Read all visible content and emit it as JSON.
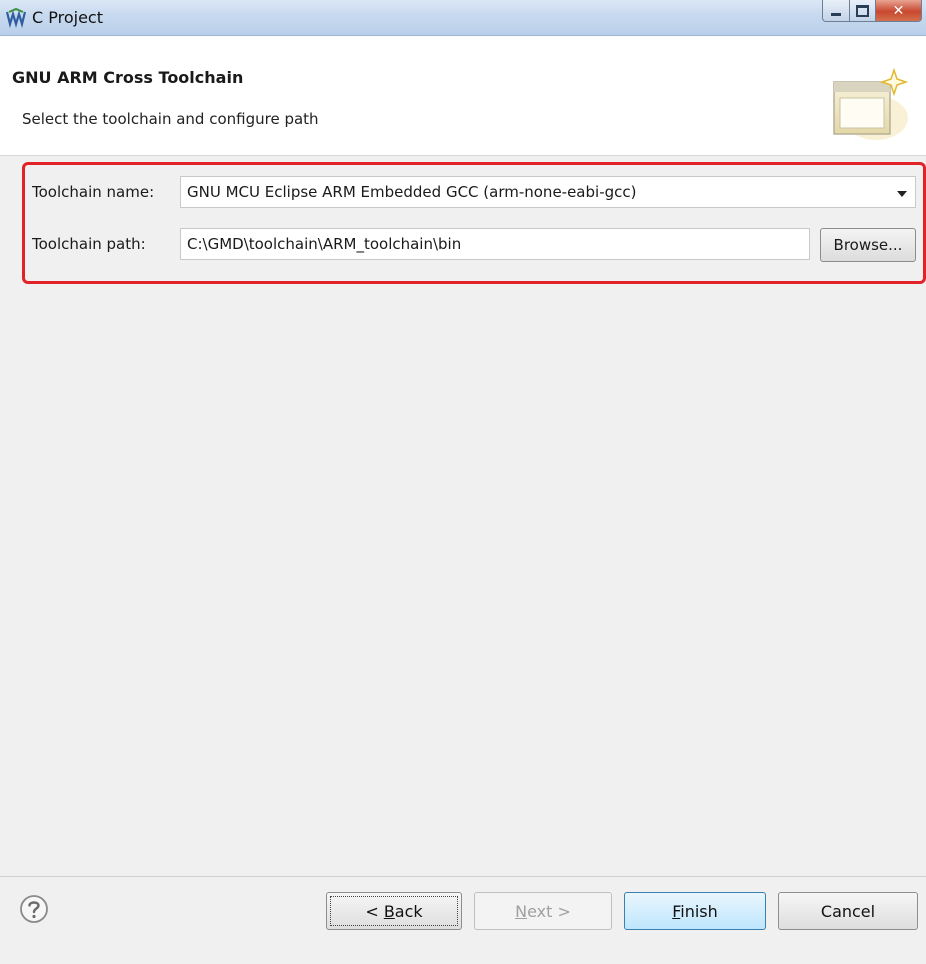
{
  "window": {
    "title": "C Project"
  },
  "header": {
    "title": "GNU ARM Cross Toolchain",
    "description": "Select the toolchain and configure path"
  },
  "form": {
    "toolchain_name_label": "Toolchain name:",
    "toolchain_name_value": "GNU MCU Eclipse ARM Embedded GCC (arm-none-eabi-gcc)",
    "toolchain_path_label": "Toolchain path:",
    "toolchain_path_value": "C:\\GMD\\toolchain\\ARM_toolchain\\bin",
    "browse_label": "Browse..."
  },
  "footer": {
    "back_prefix": "< ",
    "back_mnemonic": "B",
    "back_rest": "ack",
    "next_mnemonic": "N",
    "next_rest": "ext >",
    "finish_mnemonic": "F",
    "finish_rest": "inish",
    "cancel_label": "Cancel"
  },
  "colors": {
    "highlight_border": "#e12328",
    "body_background": "#f0f0f0",
    "titlebar": "#c7d9ef",
    "close_button": "#c8482f"
  },
  "icons": {
    "app": "eclipse-icon",
    "banner": "wizard-banner-icon",
    "help": "help-icon",
    "dropdown": "chevron-down-icon"
  },
  "state": {
    "next_enabled": false,
    "default_button": "Finish"
  }
}
